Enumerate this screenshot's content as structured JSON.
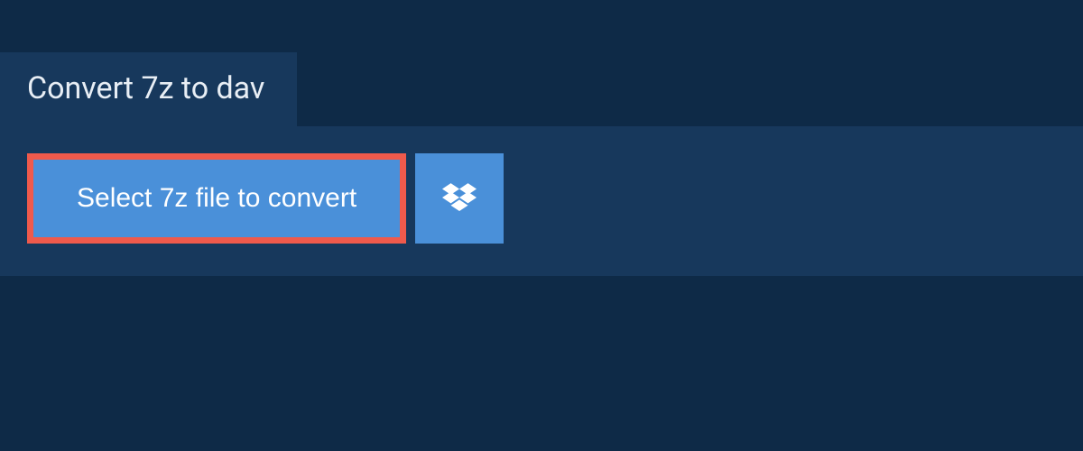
{
  "tab": {
    "title": "Convert 7z to dav"
  },
  "actions": {
    "select_label": "Select 7z file to convert"
  }
}
